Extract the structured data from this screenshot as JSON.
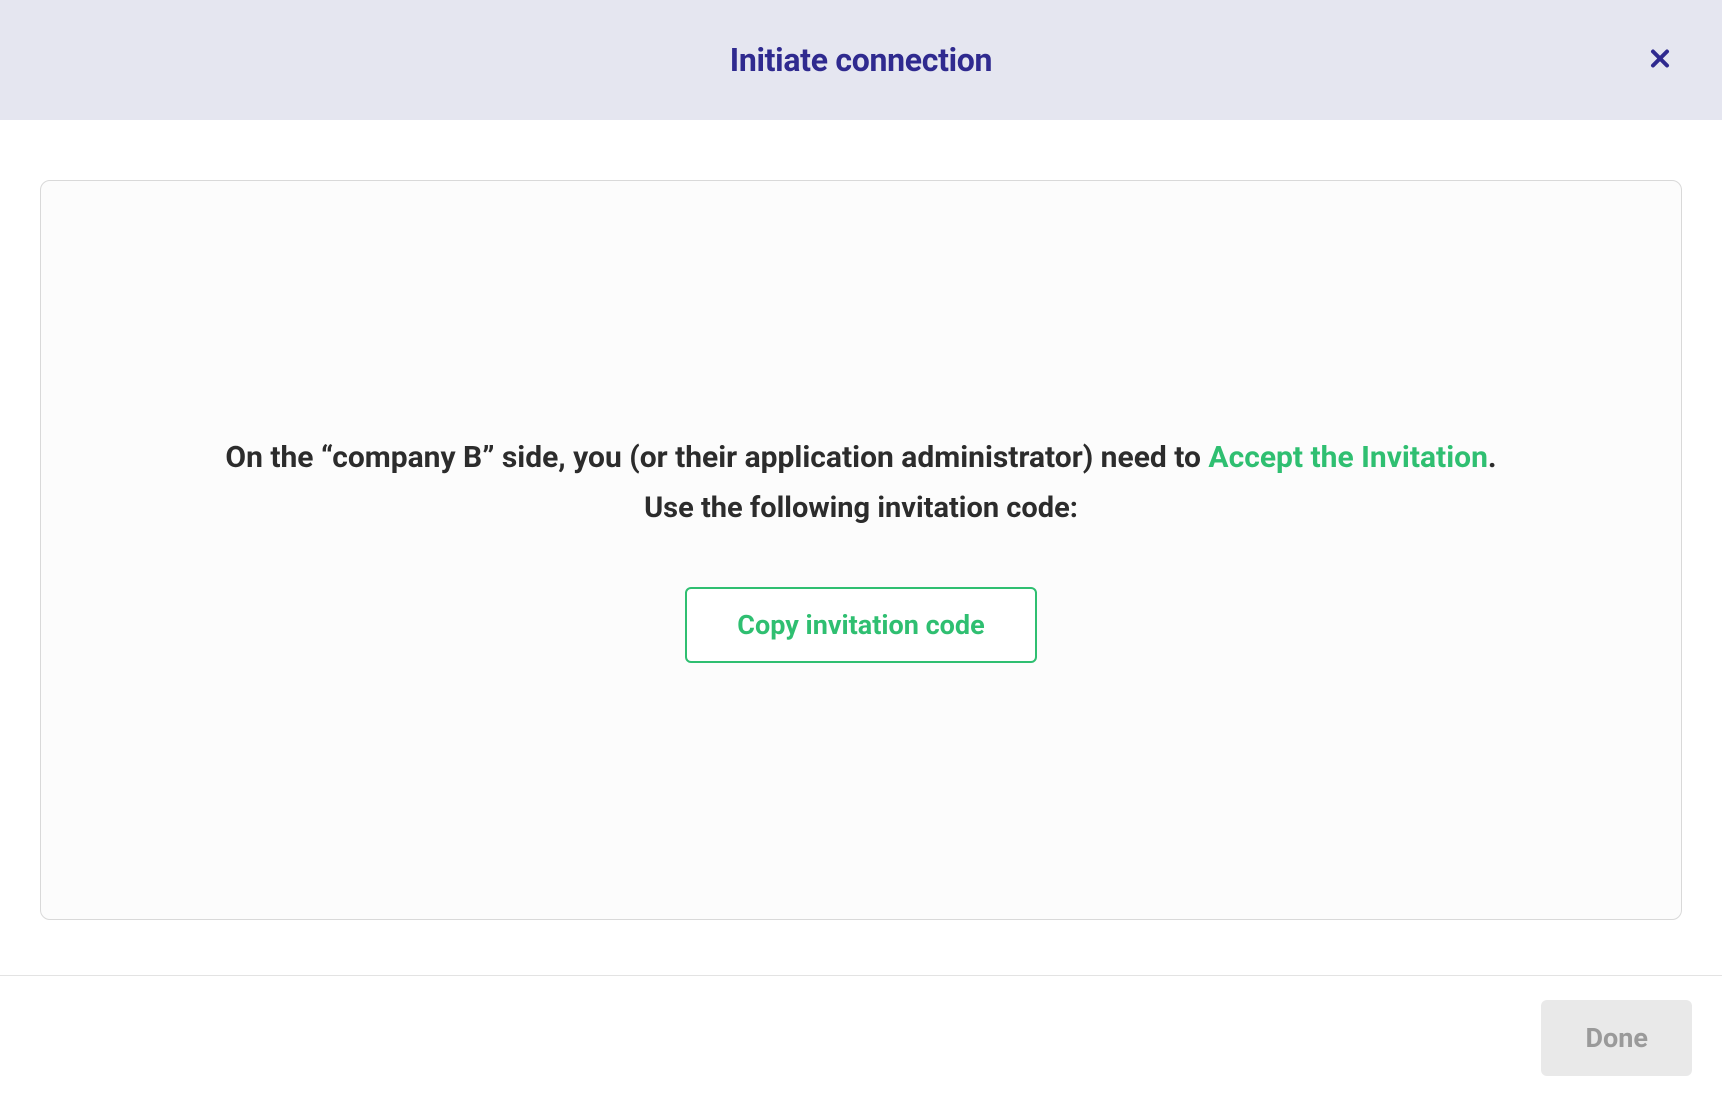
{
  "header": {
    "title": "Initiate connection"
  },
  "content": {
    "instruction_prefix": "On the “company B” side, you (or their application administrator) need to ",
    "accept_link_text": "Accept the Invitation",
    "instruction_period": ".",
    "instruction_line_2": "Use the following invitation code:",
    "copy_button_label": "Copy invitation code"
  },
  "footer": {
    "done_label": "Done"
  }
}
